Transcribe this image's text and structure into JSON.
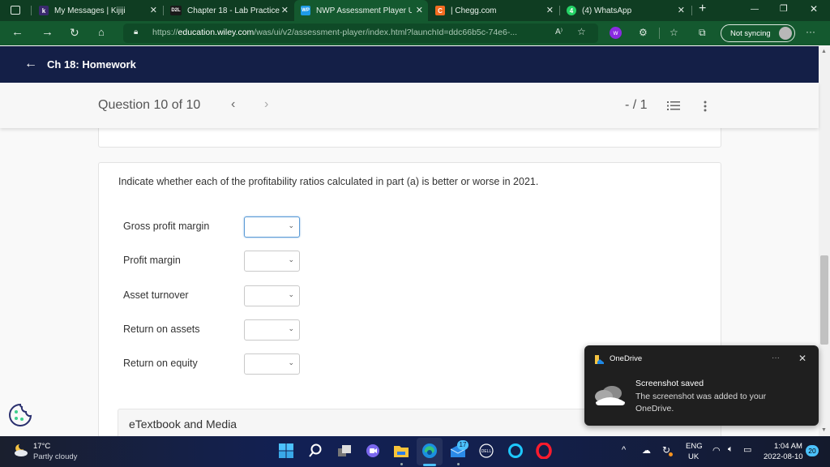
{
  "browser": {
    "tabs": [
      {
        "label": "My Messages | Kijiji",
        "icon": "kijiji-icon",
        "fav": "k",
        "fav_color": "#3a2a6e",
        "active": false
      },
      {
        "label": "Chapter 18 - Lab Practice",
        "icon": "d2l-icon",
        "fav": "D2L",
        "fav_color": "#1a1a1a",
        "active": false
      },
      {
        "label": "NWP Assessment Player U",
        "icon": "wiley-icon",
        "fav": "WP",
        "fav_color": "#1e9be8",
        "active": true
      },
      {
        "label": "| Chegg.com",
        "icon": "chegg-icon",
        "fav": "C",
        "fav_color": "#f36c21",
        "active": false
      },
      {
        "label": "(4) WhatsApp",
        "icon": "whatsapp-icon",
        "fav": "4",
        "fav_color": "#25d366",
        "active": false
      }
    ],
    "close_glyph": "✕",
    "new_tab_glyph": "+",
    "window_controls": {
      "minimize": "—",
      "maximize": "❐",
      "close": "✕"
    },
    "url_scheme": "https://",
    "url_host": "education.wiley.com",
    "url_rest": "/was/ui/v2/assessment-player/index.html?launchId=ddc66b5c-74e6-...",
    "read_aloud_glyph": "A⁾",
    "sync_label": "Not syncing",
    "more_glyph": "···"
  },
  "app": {
    "course_title": "Ch 18: Homework",
    "question_label": "Question 10 of 10",
    "prev_glyph": "‹",
    "next_glyph": "›",
    "score": "- / 1"
  },
  "question": {
    "prompt": "Indicate whether each of the profitability ratios calculated in part (a) is better or worse in 2021.",
    "rows": [
      {
        "label": "Gross profit margin",
        "value": ""
      },
      {
        "label": "Profit margin",
        "value": ""
      },
      {
        "label": "Asset turnover",
        "value": ""
      },
      {
        "label": "Return on assets",
        "value": ""
      },
      {
        "label": "Return on equity",
        "value": ""
      }
    ],
    "chevron": "⌄",
    "etextbook_label": "eTextbook and Media"
  },
  "toast": {
    "app": "OneDrive",
    "title": "Screenshot saved",
    "body": "The screenshot was added to your OneDrive.",
    "dots": "···",
    "close": "✕"
  },
  "taskbar": {
    "temperature": "17°C",
    "condition": "Partly cloudy",
    "mail_badge": "17",
    "lang_top": "ENG",
    "lang_bottom": "UK",
    "time": "1:04 AM",
    "date": "2022-08-10",
    "notification_count": "20"
  },
  "colors": {
    "tabbar": "#0f3d22",
    "toolbar": "#14592f",
    "app_header": "#141f47",
    "focus_border": "#5b9bd5"
  }
}
